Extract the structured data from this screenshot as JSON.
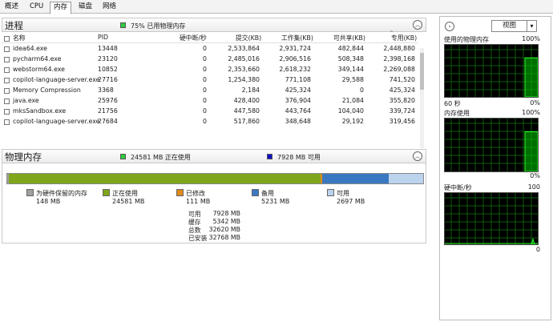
{
  "tabs": [
    "概述",
    "CPU",
    "内存",
    "磁盘",
    "网络"
  ],
  "active_tab": 2,
  "process_section": {
    "title": "进程",
    "usage_text": "75% 已用物理内存",
    "usage_color": "#2ecc40",
    "columns": [
      "名称",
      "PID",
      "硬中断/秒",
      "提交(KB)",
      "工作集(KB)",
      "可共享(KB)",
      "专用(KB)"
    ],
    "rows": [
      {
        "name": "idea64.exe",
        "pid": "13448",
        "faults": "0",
        "commit": "2,533,864",
        "working": "2,931,724",
        "shareable": "482,844",
        "private": "2,448,880"
      },
      {
        "name": "pycharm64.exe",
        "pid": "23120",
        "faults": "0",
        "commit": "2,485,016",
        "working": "2,906,516",
        "shareable": "508,348",
        "private": "2,398,168"
      },
      {
        "name": "webstorm64.exe",
        "pid": "10852",
        "faults": "0",
        "commit": "2,353,660",
        "working": "2,618,232",
        "shareable": "349,144",
        "private": "2,269,088"
      },
      {
        "name": "copilot-language-server.exe",
        "pid": "27716",
        "faults": "0",
        "commit": "1,254,380",
        "working": "771,108",
        "shareable": "29,588",
        "private": "741,520"
      },
      {
        "name": "Memory Compression",
        "pid": "3368",
        "faults": "0",
        "commit": "2,184",
        "working": "425,324",
        "shareable": "0",
        "private": "425,324"
      },
      {
        "name": "java.exe",
        "pid": "25976",
        "faults": "0",
        "commit": "428,400",
        "working": "376,904",
        "shareable": "21,084",
        "private": "355,820"
      },
      {
        "name": "mksSandbox.exe",
        "pid": "21756",
        "faults": "0",
        "commit": "447,580",
        "working": "443,764",
        "shareable": "104,040",
        "private": "339,724"
      },
      {
        "name": "copilot-language-server.exe",
        "pid": "27684",
        "faults": "0",
        "commit": "517,860",
        "working": "348,648",
        "shareable": "29,192",
        "private": "319,456"
      }
    ]
  },
  "memory_section": {
    "title": "物理内存",
    "in_use_text": "24581 MB 正在使用",
    "in_use_color": "#2ecc40",
    "available_text": "7928 MB 可用",
    "available_color": "#1010c8",
    "bar": [
      {
        "name": "hardware-reserved",
        "mb": 148,
        "color": "#a0a0a0"
      },
      {
        "name": "in-use",
        "mb": 24581,
        "color": "#7fa61a"
      },
      {
        "name": "modified",
        "mb": 111,
        "color": "#e08a1e"
      },
      {
        "name": "standby",
        "mb": 5231,
        "color": "#3a78c2"
      },
      {
        "name": "free",
        "mb": 2697,
        "color": "#bcd3ee"
      }
    ],
    "legend": [
      {
        "label": "为硬件保留的内存",
        "value": "148 MB",
        "color": "#a0a0a0"
      },
      {
        "label": "正在使用",
        "value": "24581 MB",
        "color": "#7fa61a"
      },
      {
        "label": "已修改",
        "value": "111 MB",
        "color": "#e08a1e"
      },
      {
        "label": "备用",
        "value": "5231 MB",
        "color": "#3a78c2"
      },
      {
        "label": "可用",
        "value": "2697 MB",
        "color": "#bcd3ee"
      }
    ],
    "stats": [
      {
        "label": "可用",
        "value": "7928 MB"
      },
      {
        "label": "缓存",
        "value": "5342 MB"
      },
      {
        "label": "总数",
        "value": "32620 MB"
      },
      {
        "label": "已安装",
        "value": "32768 MB"
      }
    ]
  },
  "right_panel": {
    "view_label": "视图",
    "graphs": [
      {
        "title": "使用的物理内存",
        "max": "100%",
        "bottom_left": "60 秒",
        "bottom_right": "0%",
        "level": 0.75
      },
      {
        "title": "内存使用",
        "max": "100%",
        "bottom_left": "",
        "bottom_right": "0%",
        "level": 0.75
      },
      {
        "title": "硬中断/秒",
        "max": "100",
        "bottom_left": "",
        "bottom_right": "0",
        "level": 0.1
      }
    ]
  }
}
